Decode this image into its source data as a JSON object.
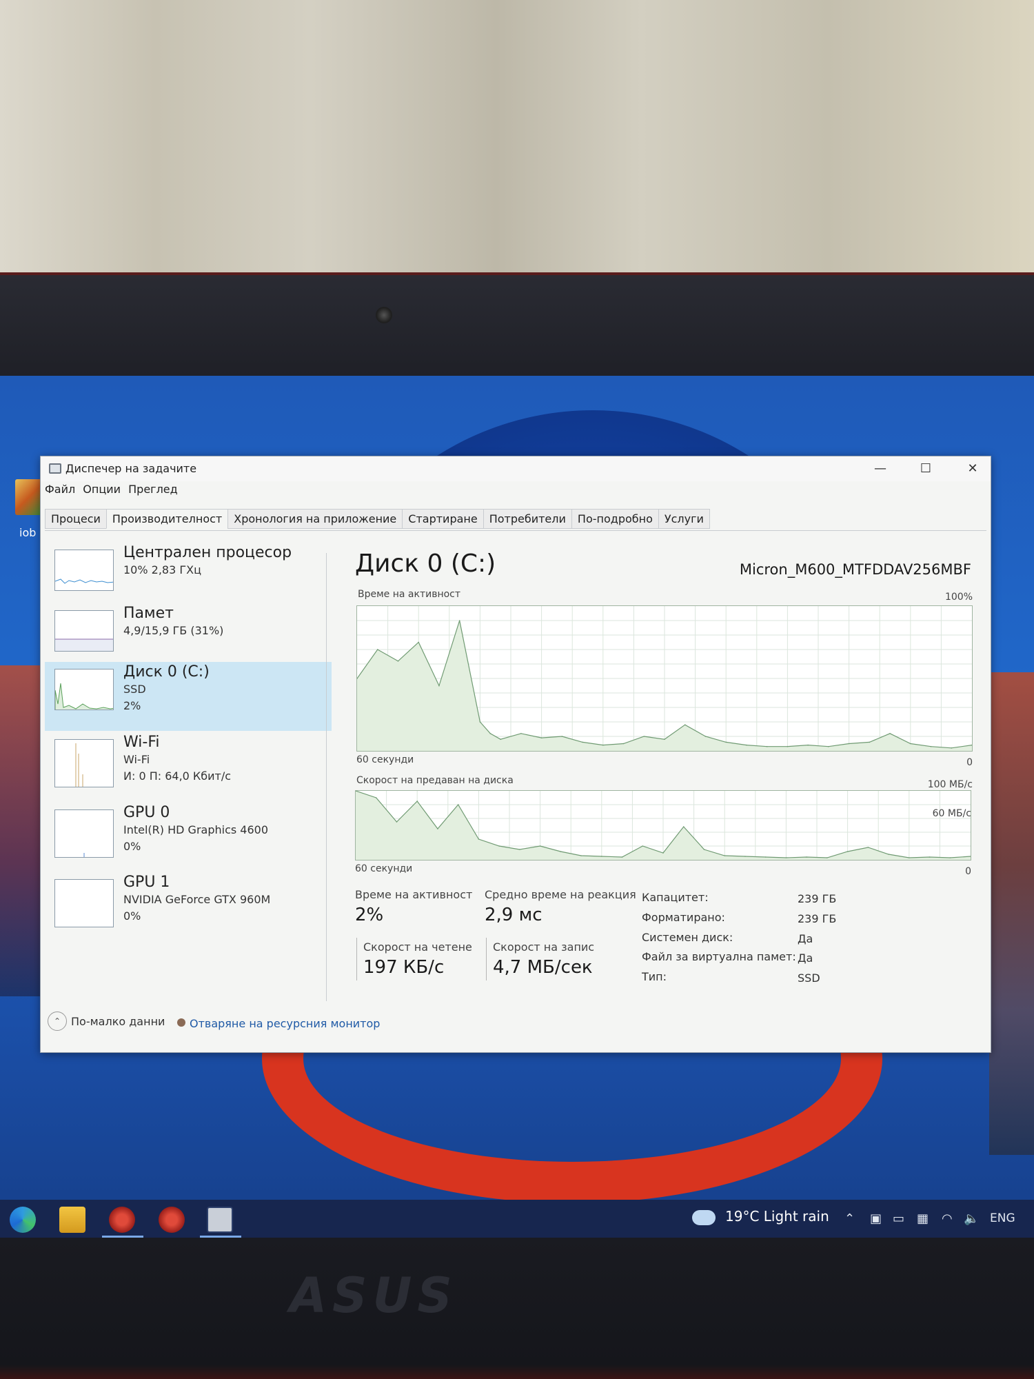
{
  "window": {
    "title": "Диспечер на задачите",
    "controls": {
      "minimize": "—",
      "maximize": "☐",
      "close": "✕"
    }
  },
  "menu": {
    "file": "Файл",
    "options": "Опции",
    "view": "Преглед"
  },
  "tabs": [
    "Процеси",
    "Производителност",
    "Хронология на приложение",
    "Стартиране",
    "Потребители",
    "По-подробно",
    "Услуги"
  ],
  "sidebar": {
    "items": [
      {
        "title": "Централен процесор",
        "sub1": "10% 2,83 ГХц",
        "sub2": ""
      },
      {
        "title": "Памет",
        "sub1": "4,9/15,9 ГБ (31%)",
        "sub2": ""
      },
      {
        "title": "Диск 0 (C:)",
        "sub1": "SSD",
        "sub2": "2%"
      },
      {
        "title": "Wi-Fi",
        "sub1": "Wi-Fi",
        "sub2": "И: 0 П: 64,0 Кбит/с"
      },
      {
        "title": "GPU 0",
        "sub1": "Intel(R) HD Graphics 4600",
        "sub2": "0%"
      },
      {
        "title": "GPU 1",
        "sub1": "NVIDIA GeForce GTX 960M",
        "sub2": "0%"
      }
    ]
  },
  "detail": {
    "title": "Диск 0 (C:)",
    "model": "Micron_M600_MTFDDAV256MBF",
    "activity_chart": {
      "label": "Време на активност",
      "max_label": "100%",
      "time_label": "60 секунди",
      "min_label": "0"
    },
    "transfer_chart": {
      "label": "Скорост на предаван на диска",
      "max_label": "100 МБ/с",
      "mid_label": "60 МБ/с",
      "time_label": "60 секунди",
      "min_label": "0"
    },
    "stats": {
      "activity_label": "Време на активност",
      "activity_value": "2%",
      "response_label": "Средно време на реакция",
      "response_value": "2,9 мс",
      "read_label": "Скорост на четене",
      "read_value": "197 КБ/с",
      "write_label": "Скорост на запис",
      "write_value": "4,7 МБ/сек"
    },
    "properties": [
      {
        "label": "Капацитет:",
        "value": "239 ГБ"
      },
      {
        "label": "Форматирано:",
        "value": "239 ГБ"
      },
      {
        "label": "Системен диск:",
        "value": "Да"
      },
      {
        "label": "Файл за виртуална памет:",
        "value": "Да"
      },
      {
        "label": "Тип:",
        "value": "SSD"
      }
    ]
  },
  "footer": {
    "fewer_details": "По-малко данни",
    "resource_monitor": "Отваряне на ресурсния монитор"
  },
  "desktop": {
    "icon_label": "iob"
  },
  "taskbar": {
    "weather": "19°C  Light rain",
    "language": "ENG"
  },
  "chart_data": [
    {
      "type": "area",
      "title": "Време на активност",
      "xlabel": "60 секунди",
      "ylim": [
        0,
        100
      ],
      "x": [
        60,
        58,
        56,
        54,
        52,
        50,
        48,
        47,
        46,
        44,
        42,
        40,
        38,
        36,
        34,
        32,
        30,
        28,
        26,
        24,
        22,
        20,
        18,
        16,
        14,
        12,
        10,
        8,
        6,
        4,
        2,
        0
      ],
      "values": [
        50,
        70,
        62,
        75,
        45,
        90,
        20,
        12,
        8,
        12,
        9,
        10,
        6,
        4,
        5,
        10,
        8,
        18,
        10,
        6,
        4,
        3,
        3,
        4,
        3,
        5,
        6,
        12,
        5,
        3,
        2,
        4
      ]
    },
    {
      "type": "line",
      "title": "Скорост на предаван на диска",
      "xlabel": "60 секунди",
      "ylim": [
        0,
        100
      ],
      "x": [
        60,
        58,
        56,
        54,
        52,
        50,
        48,
        46,
        44,
        42,
        40,
        38,
        36,
        34,
        32,
        30,
        28,
        26,
        24,
        22,
        20,
        18,
        16,
        14,
        12,
        10,
        8,
        6,
        4,
        2,
        0
      ],
      "values": [
        100,
        90,
        55,
        85,
        45,
        80,
        30,
        20,
        15,
        20,
        12,
        6,
        5,
        4,
        20,
        10,
        48,
        15,
        6,
        5,
        4,
        3,
        4,
        3,
        12,
        18,
        8,
        3,
        4,
        3,
        5
      ]
    }
  ]
}
